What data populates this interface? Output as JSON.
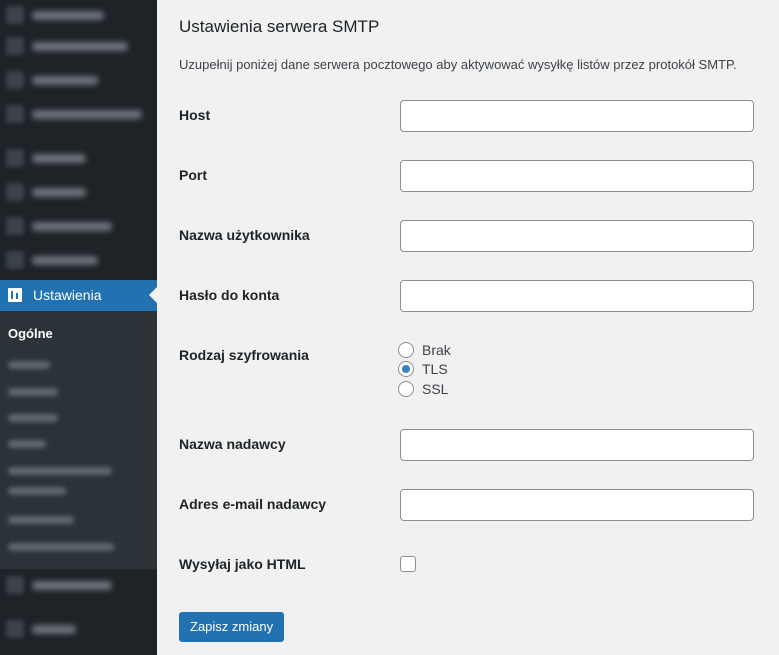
{
  "sidebar": {
    "active_item_label": "Ustawienia",
    "submenu_current": "Ogólne"
  },
  "settings": {
    "title": "Ustawienia serwera SMTP",
    "description": "Uzupełnij poniżej dane serwera pocztowego aby aktywować wysyłkę listów przez protokół SMTP.",
    "fields": {
      "host": {
        "label": "Host",
        "value": ""
      },
      "port": {
        "label": "Port",
        "value": ""
      },
      "username": {
        "label": "Nazwa użytkownika",
        "value": ""
      },
      "password": {
        "label": "Hasło do konta",
        "value": ""
      },
      "sender_name": {
        "label": "Nazwa nadawcy",
        "value": ""
      },
      "sender_email": {
        "label": "Adres e-mail nadawcy",
        "value": ""
      }
    },
    "encryption": {
      "label": "Rodzaj szyfrowania",
      "options": [
        "Brak",
        "TLS",
        "SSL"
      ],
      "selected": "TLS"
    },
    "html": {
      "label": "Wysyłaj jako HTML",
      "checked": false
    },
    "submit_label": "Zapisz zmiany"
  },
  "colors": {
    "sidebar_bg": "#1d2327",
    "accent": "#2271b1",
    "page_bg": "#f1f1f1"
  }
}
